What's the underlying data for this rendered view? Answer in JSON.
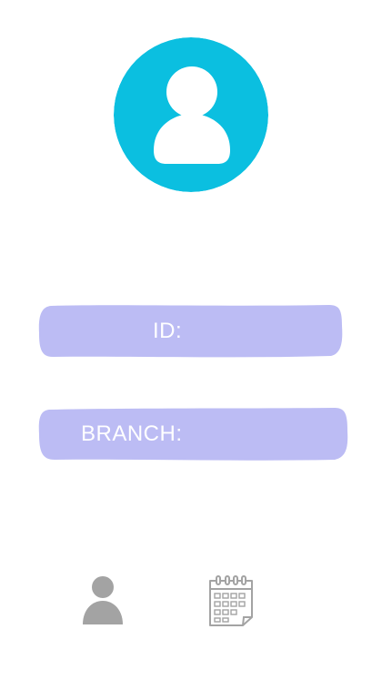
{
  "profile": {
    "avatar_icon": "user-avatar-icon",
    "avatar_color": "#0bbfe0"
  },
  "fields": {
    "id_label": "ID:",
    "branch_label": "BRANCH:",
    "field_color": "#bcbcf4"
  },
  "bottom_nav": {
    "items": [
      {
        "icon": "person-icon"
      },
      {
        "icon": "calendar-icon"
      }
    ],
    "icon_color": "#a3a3a3"
  }
}
